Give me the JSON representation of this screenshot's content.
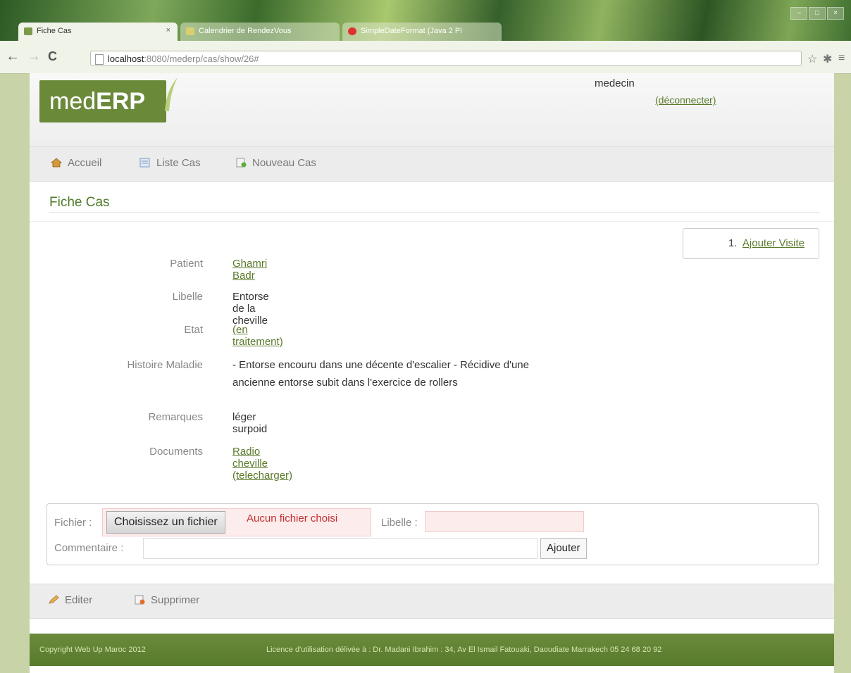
{
  "browser": {
    "tabs": [
      {
        "title": "Fiche Cas",
        "close": "×"
      },
      {
        "title": "Calendrier de RendezVous"
      },
      {
        "title": "SimpleDateFormat (Java 2 Pl"
      }
    ],
    "url_host": "localhost",
    "url_rest": ":8080/mederp/cas/show/26#"
  },
  "header": {
    "logo_light": "med",
    "logo_bold": "ERP",
    "username": "medecin",
    "logout": "(déconnecter)"
  },
  "menu": {
    "home": "Accueil",
    "list": "Liste Cas",
    "new": "Nouveau Cas"
  },
  "page_title": "Fiche Cas",
  "visit": {
    "number": "1.",
    "link": "Ajouter Visite"
  },
  "details": {
    "patient_label": "Patient",
    "patient_value": "Ghamri Badr",
    "libelle_label": "Libelle",
    "libelle_value": "Entorse de la cheville",
    "etat_label": "Etat",
    "etat_value": "(en traitement)",
    "histoire_label": "Histoire Maladie",
    "histoire_line1": "- Entorse encouru dans une décente d'escalier - Récidive d'une",
    "histoire_line2": "ancienne entorse subit dans l'exercice de rollers",
    "remarques_label": "Remarques",
    "remarques_value": "léger surpoid",
    "documents_label": "Documents",
    "document_name": "Radio cheville",
    "document_download": "(telecharger)"
  },
  "upload": {
    "file_label": "Fichier :",
    "choose_button": "Choisissez un fichier",
    "no_file": "Aucun fichier choisi",
    "libelle_label": "Libelle :",
    "comment_label": "Commentaire :",
    "add_button": "Ajouter"
  },
  "actions": {
    "edit": "Editer",
    "delete": "Supprimer"
  },
  "footer": {
    "copyright": "Copyright Web Up Maroc 2012",
    "license": "Licence d'utilisation délivée à : Dr. Madani Ibrahim : 34, Av El Ismail Fatouaki, Daoudiate Marrakech 05 24 68 20 92"
  },
  "colors": {
    "brand_green": "#5a7a2a",
    "footer_green": "#6b8b3c",
    "error_red": "#c03030"
  }
}
